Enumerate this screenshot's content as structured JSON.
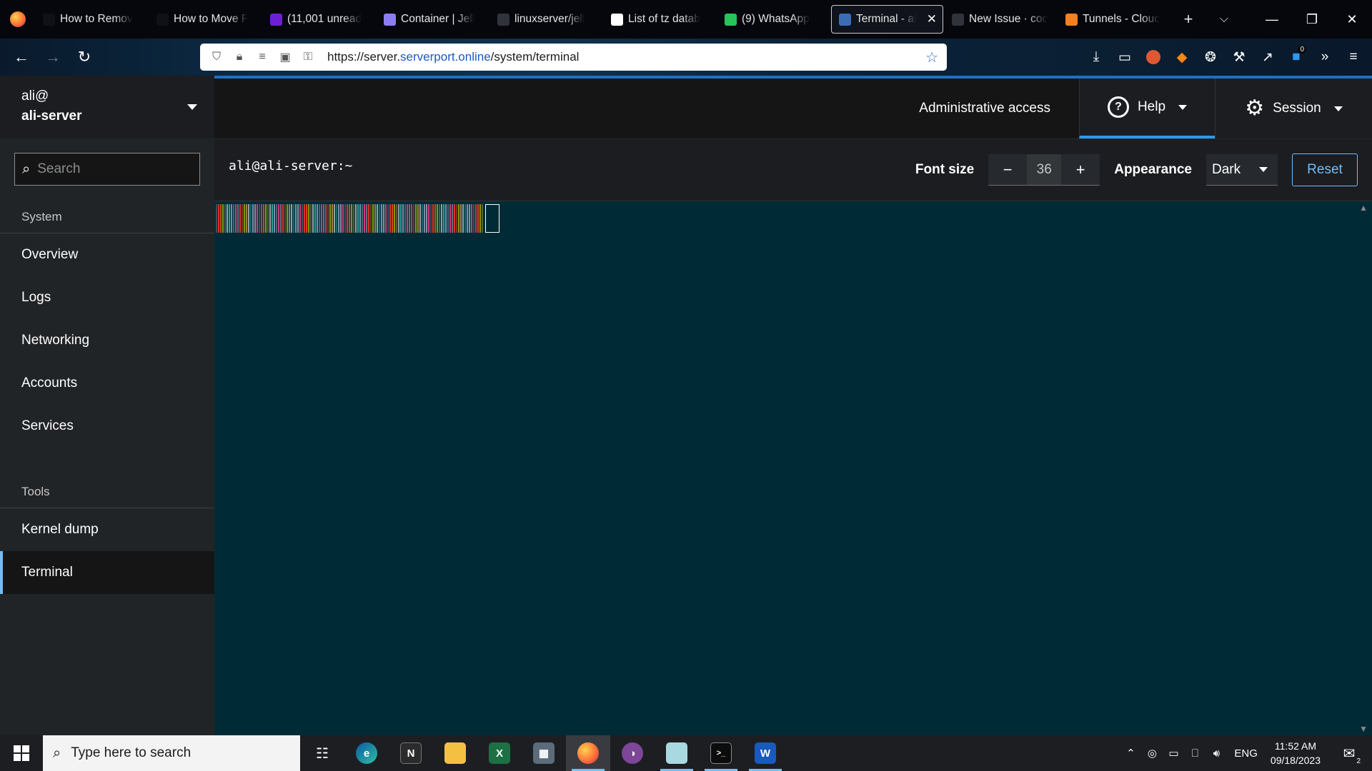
{
  "browser": {
    "tabs": [
      {
        "label": "How to Remov",
        "icon": "globe-icon",
        "color": "#0f1117"
      },
      {
        "label": "How to Move F",
        "icon": "globe-icon",
        "color": "#0f1117"
      },
      {
        "label": "(11,001 unread",
        "icon": "mail-icon",
        "color": "#6d1fd6"
      },
      {
        "label": "Container | Jell",
        "icon": "triangle-icon",
        "color": "#8c7ef2"
      },
      {
        "label": "linuxserver/jell",
        "icon": "github-icon",
        "color": "#30343a"
      },
      {
        "label": "List of tz datab",
        "icon": "wikipedia-icon",
        "color": "#ffffff"
      },
      {
        "label": "(9) WhatsApp",
        "icon": "whatsapp-icon",
        "color": "#27c45b"
      },
      {
        "label": "Terminal - al",
        "icon": "cockpit-icon",
        "color": "#3a6db5",
        "active": true
      },
      {
        "label": "New Issue · coc",
        "icon": "github-icon",
        "color": "#30343a"
      },
      {
        "label": "Tunnels - Clouc",
        "icon": "cloudflare-icon",
        "color": "#f48120"
      }
    ],
    "url_prefix": "https://server.",
    "url_domain": "serverport.online",
    "url_path": "/system/terminal",
    "toolbar_badge": "0"
  },
  "cockpit": {
    "user": "ali@",
    "host": "ali-server",
    "search_placeholder": "Search",
    "system_section": "System",
    "system_items": [
      "Overview",
      "Logs",
      "Networking",
      "Accounts",
      "Services"
    ],
    "tools_section": "Tools",
    "tools_items": [
      "Kernel dump",
      "Terminal"
    ],
    "active_item": "Terminal",
    "admin_access": "Administrative access",
    "help": "Help",
    "session": "Session",
    "terminal_title": "ali@ali-server:~",
    "font_size_label": "Font size",
    "font_size_value": "36",
    "font_minus": "−",
    "font_plus": "+",
    "appearance_label": "Appearance",
    "appearance_value": "Dark",
    "reset": "Reset",
    "terminal_bg": "#002b36",
    "accent": "#73bcf7"
  },
  "taskbar": {
    "search_placeholder": "Type here to search",
    "language": "ENG",
    "time": "11:52 AM",
    "date": "09/18/2023",
    "notification_count": "2"
  }
}
